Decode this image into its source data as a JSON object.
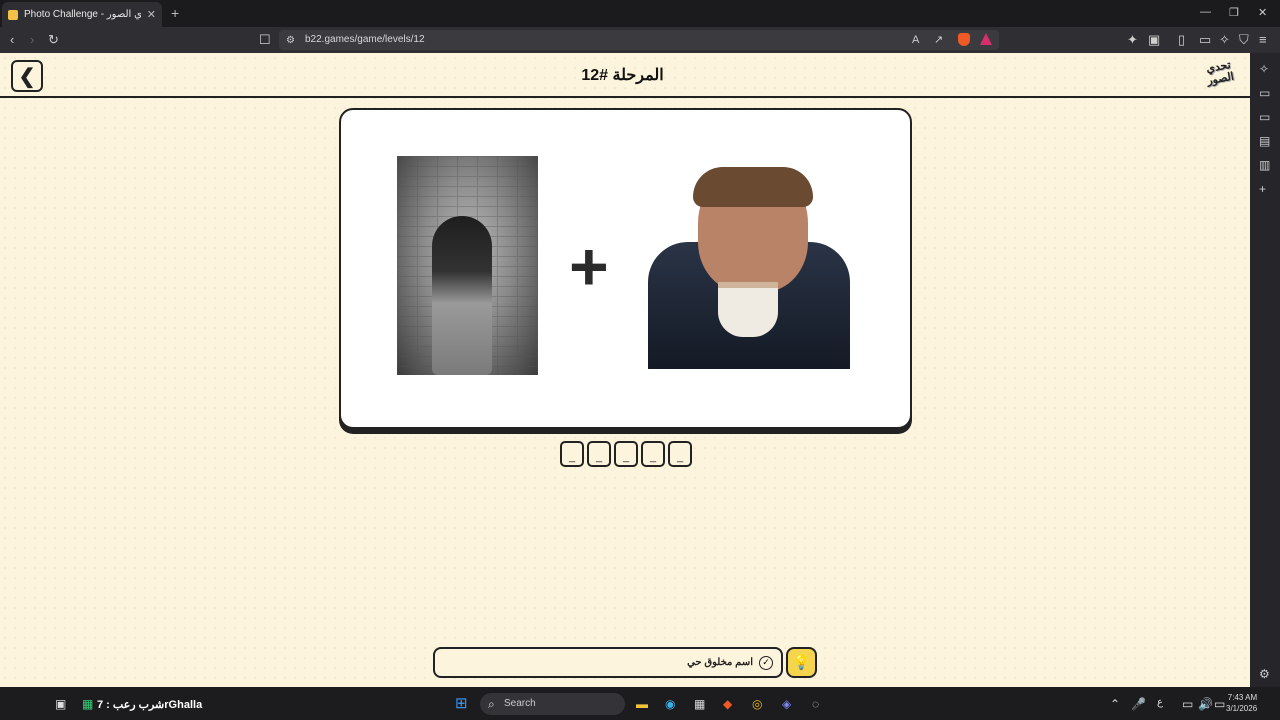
{
  "browser": {
    "tab_title": "Photo Challenge - تحدي الصور",
    "url": "b22.games/game/levels/12"
  },
  "page": {
    "level_title": "المرحلة #12",
    "logo_text": "تحدي الصور",
    "back_icon": "chevron-left-icon",
    "answer_slots": [
      "_",
      "_",
      "_",
      "_",
      "_"
    ],
    "hint": "اسم مخلوق حي",
    "hint_icon": "hint-badge-icon",
    "bulb_icon": "lightbulb-icon"
  },
  "taskbar": {
    "app_label": "شرب رعب : 7rGhalla",
    "search_label": "Search",
    "time": "7:43 AM",
    "date": "3/1/2026",
    "lang": "ع"
  }
}
